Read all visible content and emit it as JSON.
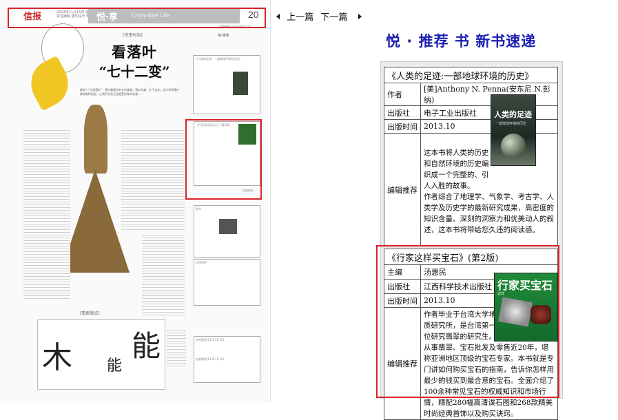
{
  "newspaper": {
    "brand": "信报",
    "dateline": "2013年11月15日 星期五 责任编辑 版式设计 校对",
    "section": "悦·享",
    "section_en": "Enjoyable Life",
    "page_number": "20",
    "editor_line": "主编邮箱 jsbs@163.com",
    "column_tag": "[悦享时尚]",
    "headline_line1": "看落叶",
    "headline_line2": "“七十二变”",
    "lead": "都说“人生如落叶”，落叶飘零也有它的美丽。落叶的美，在于变化。设计师将落叶做成各种造型，让我们在秋天里感受别样的浪漫……",
    "sub_tag": "[看图我说]",
    "calligraphy_1": "木",
    "calligraphy_2": "能",
    "calligraphy_3": "能",
    "side_title_1": "悦·推荐",
    "side_book1_title": "《人类的足迹：一部地球环境的历史》",
    "side_book2_title": "《行家这样买宝石》(第2版)",
    "side_new_title": "图书",
    "side_art_title": "ARTPOP",
    "side_rank_1": "内地票房(11.4-11.10)",
    "side_rank_2": "北美票房(11.8-11.10)",
    "side_credit": "信报综合"
  },
  "nav": {
    "prev": "上一篇",
    "next": "下一篇"
  },
  "page_title": "悦 · 推荐  书  新书速递",
  "books": [
    {
      "title": "《人类的足迹:一部地球环境的历史》",
      "author_label": "作者",
      "author": "[美]Anthony N. Penna(安东尼.N.彭纳)",
      "publisher_label": "出版社",
      "publisher": "电子工业出版社",
      "date_label": "出版时间",
      "date": "2013.10",
      "rec_label": "编辑推荐",
      "rec_short": "这本书将人类的历史和自然环境的历史编织成一个完整的、引人入胜的故事。",
      "rec_long": "作者综合了地理学、气象学、考古学、人类学及历史学的最新研究成果，高密度的知识含量、深刻的洞察力和优美动人的叙述，这本书将带给您久违的阅读感。",
      "cover_title": "人类的足迹",
      "cover_subtitle": "一部地球环境的历史"
    },
    {
      "title": "《行家这样买宝石》(第2版)",
      "author_label": "主编",
      "author": "汤惠民",
      "publisher_label": "出版社",
      "publisher": "江西科学技术出版社",
      "date_label": "出版时间",
      "date": "2013.10",
      "rec_label": "编辑推荐",
      "rec_short": "作者毕业于台湾大学地质研究所，是台湾第一位研究翡翠的研究生。",
      "rec_long": "从事翡翠、宝石批发及零售近20年，堪称亚洲地区顶级的宝石专家。本书就是专门讲如何购买宝石的指南，告诉你怎样用最少的钱买到最合意的宝石。全面介绍了100余种常见宝石的权威知识和市场行情，精配280幅高清谍石图和268款精美时尚经典首饰以及购买诀窍。",
      "cover_title": "行家买宝石",
      "cover_subtitle": "这样"
    }
  ],
  "colors": {
    "title_blue": "#1a1fb0",
    "highlight_red": "#d9232a"
  }
}
